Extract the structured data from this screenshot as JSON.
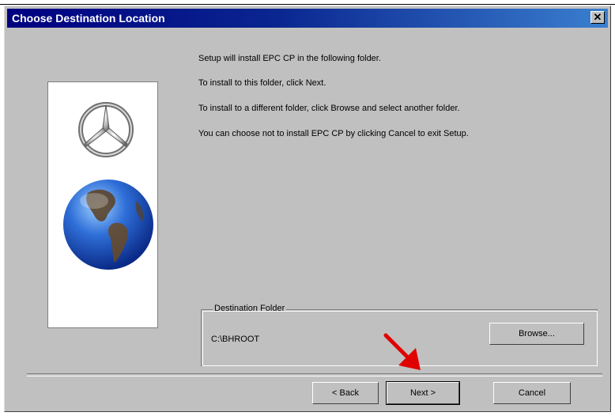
{
  "window": {
    "title": "Choose Destination Location",
    "close_glyph": "✕"
  },
  "body": {
    "line1": "Setup will install EPC CP in the following folder.",
    "line2": "To install to this folder, click Next.",
    "line3": "To install to a different folder, click Browse and select another folder.",
    "line4": "You can choose not to install EPC CP by clicking Cancel to exit Setup."
  },
  "destination": {
    "group_label": "Destination Folder",
    "path": "C:\\BHROOT",
    "browse_label": "Browse..."
  },
  "buttons": {
    "back_label": "< Back",
    "next_label": "Next >",
    "cancel_label": "Cancel"
  },
  "colors": {
    "annotation_arrow": "#e00000",
    "titlebar": "#000080"
  }
}
